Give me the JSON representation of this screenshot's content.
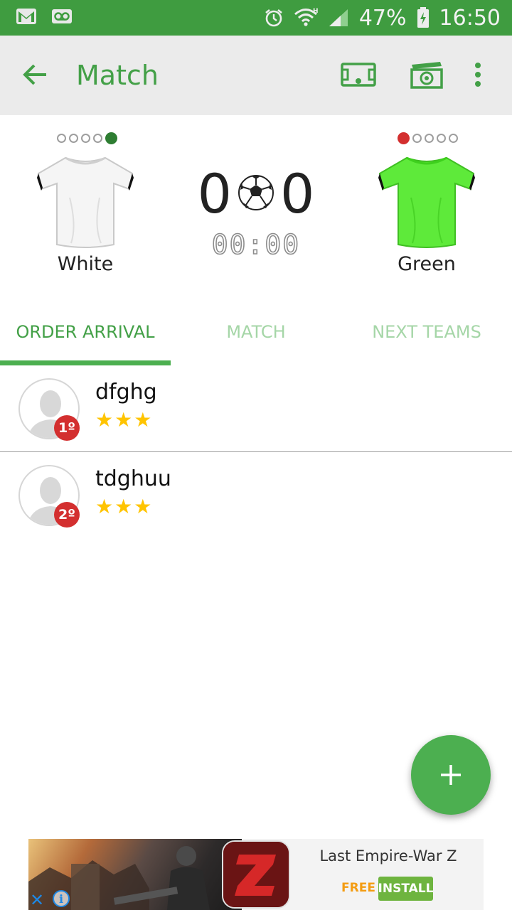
{
  "status_bar": {
    "icons_left": [
      "gmail-icon",
      "voicemail-icon"
    ],
    "icons_right": [
      "alarm-icon",
      "wifi-icon",
      "signal-icon",
      "battery-charging-icon"
    ],
    "network_type": "H",
    "battery": "47%",
    "time": "16:50"
  },
  "toolbar": {
    "title": "Match",
    "actions": [
      "field-icon",
      "ball-clapper-icon",
      "more-vert-icon"
    ]
  },
  "match": {
    "home": {
      "name": "White",
      "shirt_color": "#f4f4f4",
      "active_dot_color": "#2e7d32",
      "dots": 5,
      "active_dot_index": 4
    },
    "away": {
      "name": "Green",
      "shirt_color": "#5eea3a",
      "active_dot_color": "#d32f2f",
      "dots": 5,
      "active_dot_index": 0
    },
    "home_score": "0",
    "away_score": "0",
    "clock": "00:00"
  },
  "tabs": [
    {
      "label": "ORDER ARRIVAL",
      "active": true
    },
    {
      "label": "MATCH",
      "active": false
    },
    {
      "label": "NEXT TEAMS",
      "active": false
    }
  ],
  "players": [
    {
      "name": "dfghg",
      "rank": "1º",
      "rating": 3
    },
    {
      "name": "tdghuu",
      "rank": "2º",
      "rating": 3
    }
  ],
  "fab": {
    "icon": "plus-icon"
  },
  "ad": {
    "title": "Last Empire-War Z",
    "price": "FREE",
    "cta": "INSTALL",
    "app_icon_letter": "Z"
  },
  "colors": {
    "primary": "#43a047",
    "status_bar": "#3f9c40",
    "accent_fab": "#4caf50",
    "star": "#ffc400",
    "rank_badge": "#d32f2f"
  }
}
